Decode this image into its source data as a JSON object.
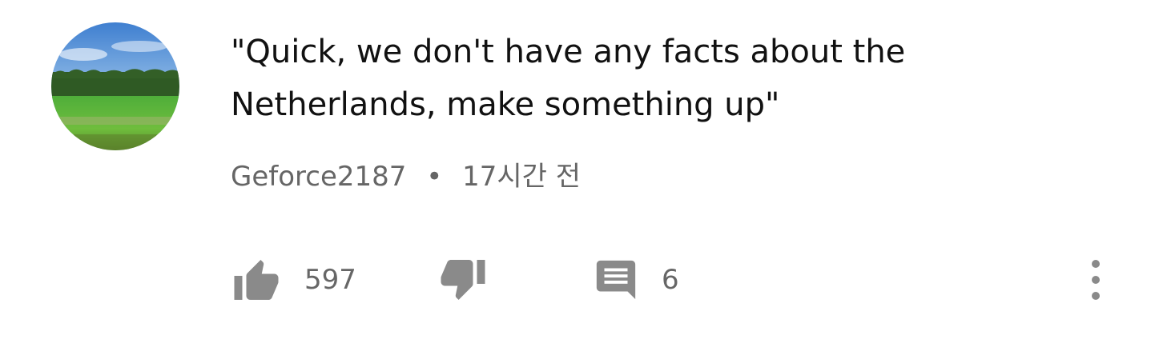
{
  "comment": {
    "text": "\"Quick, we don't have any facts about the\nNetherlands, make something up\"",
    "author": "Geforce2187",
    "separator": "•",
    "time": "17시간 전"
  },
  "actions": {
    "like_count": "597",
    "reply_count": "6"
  },
  "icons": {
    "avatar": "avatar-landscape-image",
    "like": "thumb-up-icon",
    "dislike": "thumb-down-icon",
    "reply": "comment-icon",
    "more": "more-vert-icon"
  },
  "colors": {
    "icon": "#8a8a8a",
    "text": "#111111",
    "meta": "#666666"
  }
}
